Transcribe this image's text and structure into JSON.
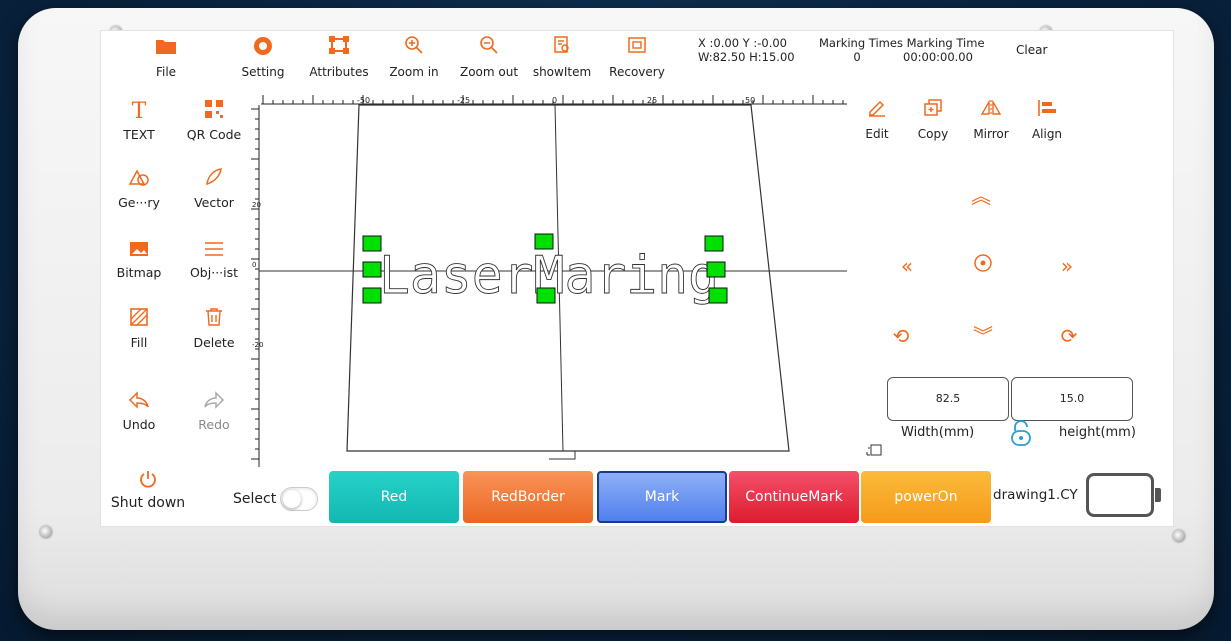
{
  "toolbar": {
    "items": [
      {
        "label": "File",
        "icon": "folder-icon"
      },
      {
        "label": "Setting",
        "icon": "gear-icon"
      },
      {
        "label": "Attributes",
        "icon": "attributes-icon"
      },
      {
        "label": "Zoom in",
        "icon": "zoom-in-icon"
      },
      {
        "label": "Zoom out",
        "icon": "zoom-out-icon"
      },
      {
        "label": "showItem",
        "icon": "show-item-icon"
      },
      {
        "label": "Recovery",
        "icon": "recovery-icon"
      }
    ],
    "coords": {
      "line1": "X :0.00  Y :-0.00",
      "line2": "W:82.50  H:15.00"
    },
    "marking": {
      "times_label": "Marking Times",
      "time_label": "Marking Time",
      "times_value": "0",
      "time_value": "00:00:00.00"
    },
    "clear_label": "Clear"
  },
  "left_panel": {
    "items": [
      {
        "label": "TEXT",
        "icon": "text-icon"
      },
      {
        "label": "QR Code",
        "icon": "qr-code-icon"
      },
      {
        "label": "Ge···ry",
        "icon": "geometry-icon"
      },
      {
        "label": "Vector",
        "icon": "vector-icon"
      },
      {
        "label": "Bitmap",
        "icon": "bitmap-icon"
      },
      {
        "label": "Obj···ist",
        "icon": "object-list-icon"
      },
      {
        "label": "Fill",
        "icon": "fill-icon"
      },
      {
        "label": "Delete",
        "icon": "trash-icon"
      },
      {
        "label": "Undo",
        "icon": "undo-icon"
      },
      {
        "label": "Redo",
        "icon": "redo-icon"
      }
    ]
  },
  "canvas": {
    "text": "LaserMaring",
    "ruler_top_labels": [
      "-50",
      "-25",
      "0",
      "25",
      "50"
    ],
    "ruler_left_labels": [
      "20",
      "0",
      "-20"
    ]
  },
  "right_panel": {
    "items": [
      {
        "label": "Edit",
        "icon": "edit-icon"
      },
      {
        "label": "Copy",
        "icon": "copy-icon"
      },
      {
        "label": "Mirror",
        "icon": "mirror-icon"
      },
      {
        "label": "Align",
        "icon": "align-icon"
      }
    ],
    "width_value": "82.5",
    "height_value": "15.0",
    "width_label": "Width(mm)",
    "height_label": "height(mm)"
  },
  "bottom": {
    "shutdown_label": "Shut down",
    "select_label": "Select",
    "buttons": [
      {
        "label": "Red",
        "color": "#1ec8c0"
      },
      {
        "label": "RedBorder",
        "color": "#f07a3c"
      },
      {
        "label": "Mark",
        "color": "#5c8ef2"
      },
      {
        "label": "ContinueMark",
        "color": "#ea2a3e"
      },
      {
        "label": "powerOn",
        "color": "#f9a422"
      }
    ],
    "filename": "drawing1.CY"
  },
  "colors": {
    "accent": "#ef6a1f",
    "handle": "#00e000"
  }
}
